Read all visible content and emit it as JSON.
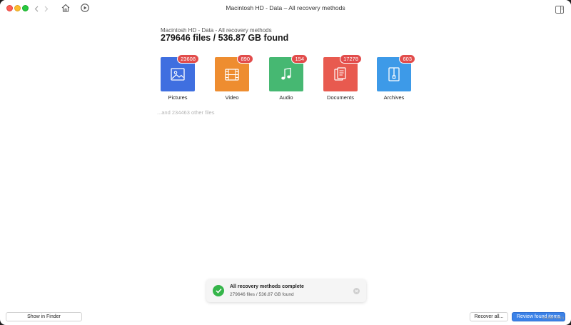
{
  "window": {
    "title": "Macintosh HD - Data – All recovery methods"
  },
  "header": {
    "breadcrumb": "Macintosh HD - Data - All recovery methods",
    "title": "279646 files / 536.87 GB found"
  },
  "categories": [
    {
      "label": "Pictures",
      "count": "23608",
      "color": "#3f6fe0",
      "icon": "image-icon"
    },
    {
      "label": "Video",
      "count": "890",
      "color": "#ee8d30",
      "icon": "film-icon"
    },
    {
      "label": "Audio",
      "count": "154",
      "color": "#46b872",
      "icon": "music-note-icon"
    },
    {
      "label": "Documents",
      "count": "17278",
      "color": "#e85a4f",
      "icon": "document-icon"
    },
    {
      "label": "Archives",
      "count": "603",
      "color": "#3d9ae8",
      "icon": "archive-icon"
    }
  ],
  "other_files": "...and 234463 other files",
  "toast": {
    "title": "All recovery methods complete",
    "subtitle": "279646 files / 536.87 GB found"
  },
  "buttons": {
    "show_in_finder": "Show in Finder",
    "recover_all": "Recover all...",
    "review_found": "Review found items"
  },
  "watermark": "wsxdn.com"
}
